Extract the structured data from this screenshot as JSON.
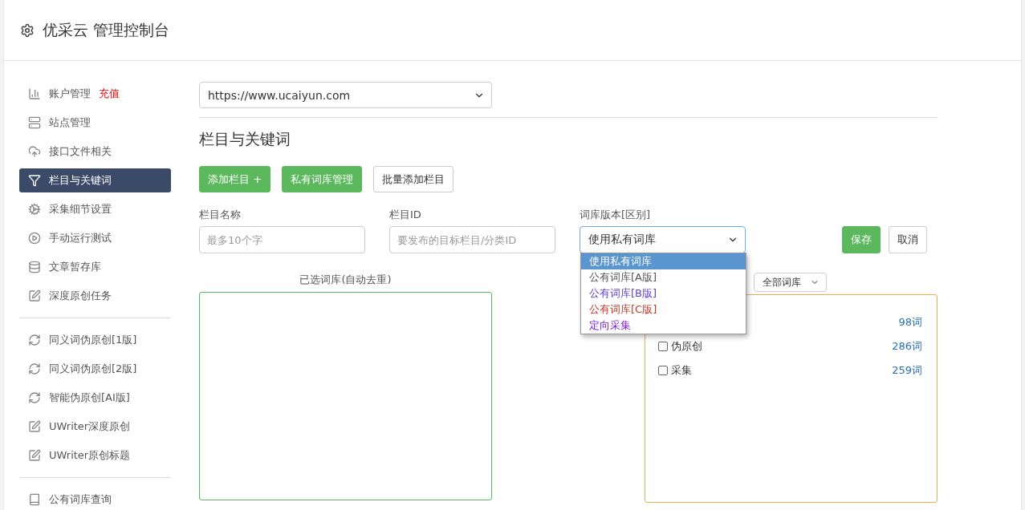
{
  "header": {
    "title": "优采云 管理控制台"
  },
  "sidebar": {
    "groups": [
      {
        "items": [
          {
            "kind": "chart",
            "label": "账户管理",
            "badge": "充值",
            "selected": false
          },
          {
            "kind": "server",
            "label": "站点管理",
            "selected": false
          },
          {
            "kind": "cloud",
            "label": "接口文件相关",
            "selected": false
          },
          {
            "kind": "filter",
            "label": "栏目与关键词",
            "selected": true
          },
          {
            "kind": "cogs",
            "label": "采集细节设置",
            "selected": false
          },
          {
            "kind": "play",
            "label": "手动运行测试",
            "selected": false
          },
          {
            "kind": "database",
            "label": "文章暂存库",
            "selected": false
          },
          {
            "kind": "edit",
            "label": "深度原创任务",
            "selected": false
          }
        ]
      },
      {
        "items": [
          {
            "kind": "refresh",
            "label": "同义词伪原创[1版]",
            "selected": false
          },
          {
            "kind": "refresh",
            "label": "同义词伪原创[2版]",
            "selected": false
          },
          {
            "kind": "refresh",
            "label": "智能伪原创[AI版]",
            "selected": false
          },
          {
            "kind": "edit",
            "label": "UWriter深度原创",
            "selected": false
          },
          {
            "kind": "edit",
            "label": "UWriter原创标题",
            "selected": false
          }
        ]
      },
      {
        "items": [
          {
            "kind": "book",
            "label": "公有词库查询",
            "selected": false
          }
        ]
      }
    ]
  },
  "site_select": {
    "value": "https://www.ucaiyun.com"
  },
  "heading": "栏目与关键词",
  "toolbar": [
    {
      "label": "添加栏目 +",
      "kind": "primary"
    },
    {
      "label": "私有词库管理",
      "kind": "primary"
    },
    {
      "label": "批量添加栏目",
      "kind": "default"
    }
  ],
  "form": {
    "fields": [
      {
        "label": "栏目名称",
        "placeholder": "最多10个字"
      },
      {
        "label": "栏目ID",
        "placeholder": "要发布的目标栏目/分类ID"
      }
    ],
    "version": {
      "label": "词库版本[区别]",
      "value": "使用私有词库",
      "expanded": true,
      "options": [
        {
          "label": "使用私有词库",
          "selected": true
        },
        {
          "label": "公有词库[A版]",
          "selected": false,
          "color": "#555555"
        },
        {
          "label": "公有词库[B版]",
          "selected": false,
          "color": "#5b3fd9"
        },
        {
          "label": "公有词库[C版]",
          "selected": false,
          "color": "#c0392b"
        },
        {
          "label": "定向采集",
          "selected": false,
          "color": "#7a1fd6"
        }
      ]
    },
    "buttons": [
      {
        "label": "保存",
        "kind": "primary"
      },
      {
        "label": "取消",
        "kind": "default"
      }
    ]
  },
  "selected_library": {
    "title": "已选词库(自动去重)"
  },
  "library_filter": {
    "value": "全部词库"
  },
  "library_list": [
    {
      "count": "98词"
    },
    {
      "label": "伪原创",
      "checked": false,
      "count": "286词"
    },
    {
      "label": "采集",
      "checked": false,
      "count": "259词"
    }
  ]
}
